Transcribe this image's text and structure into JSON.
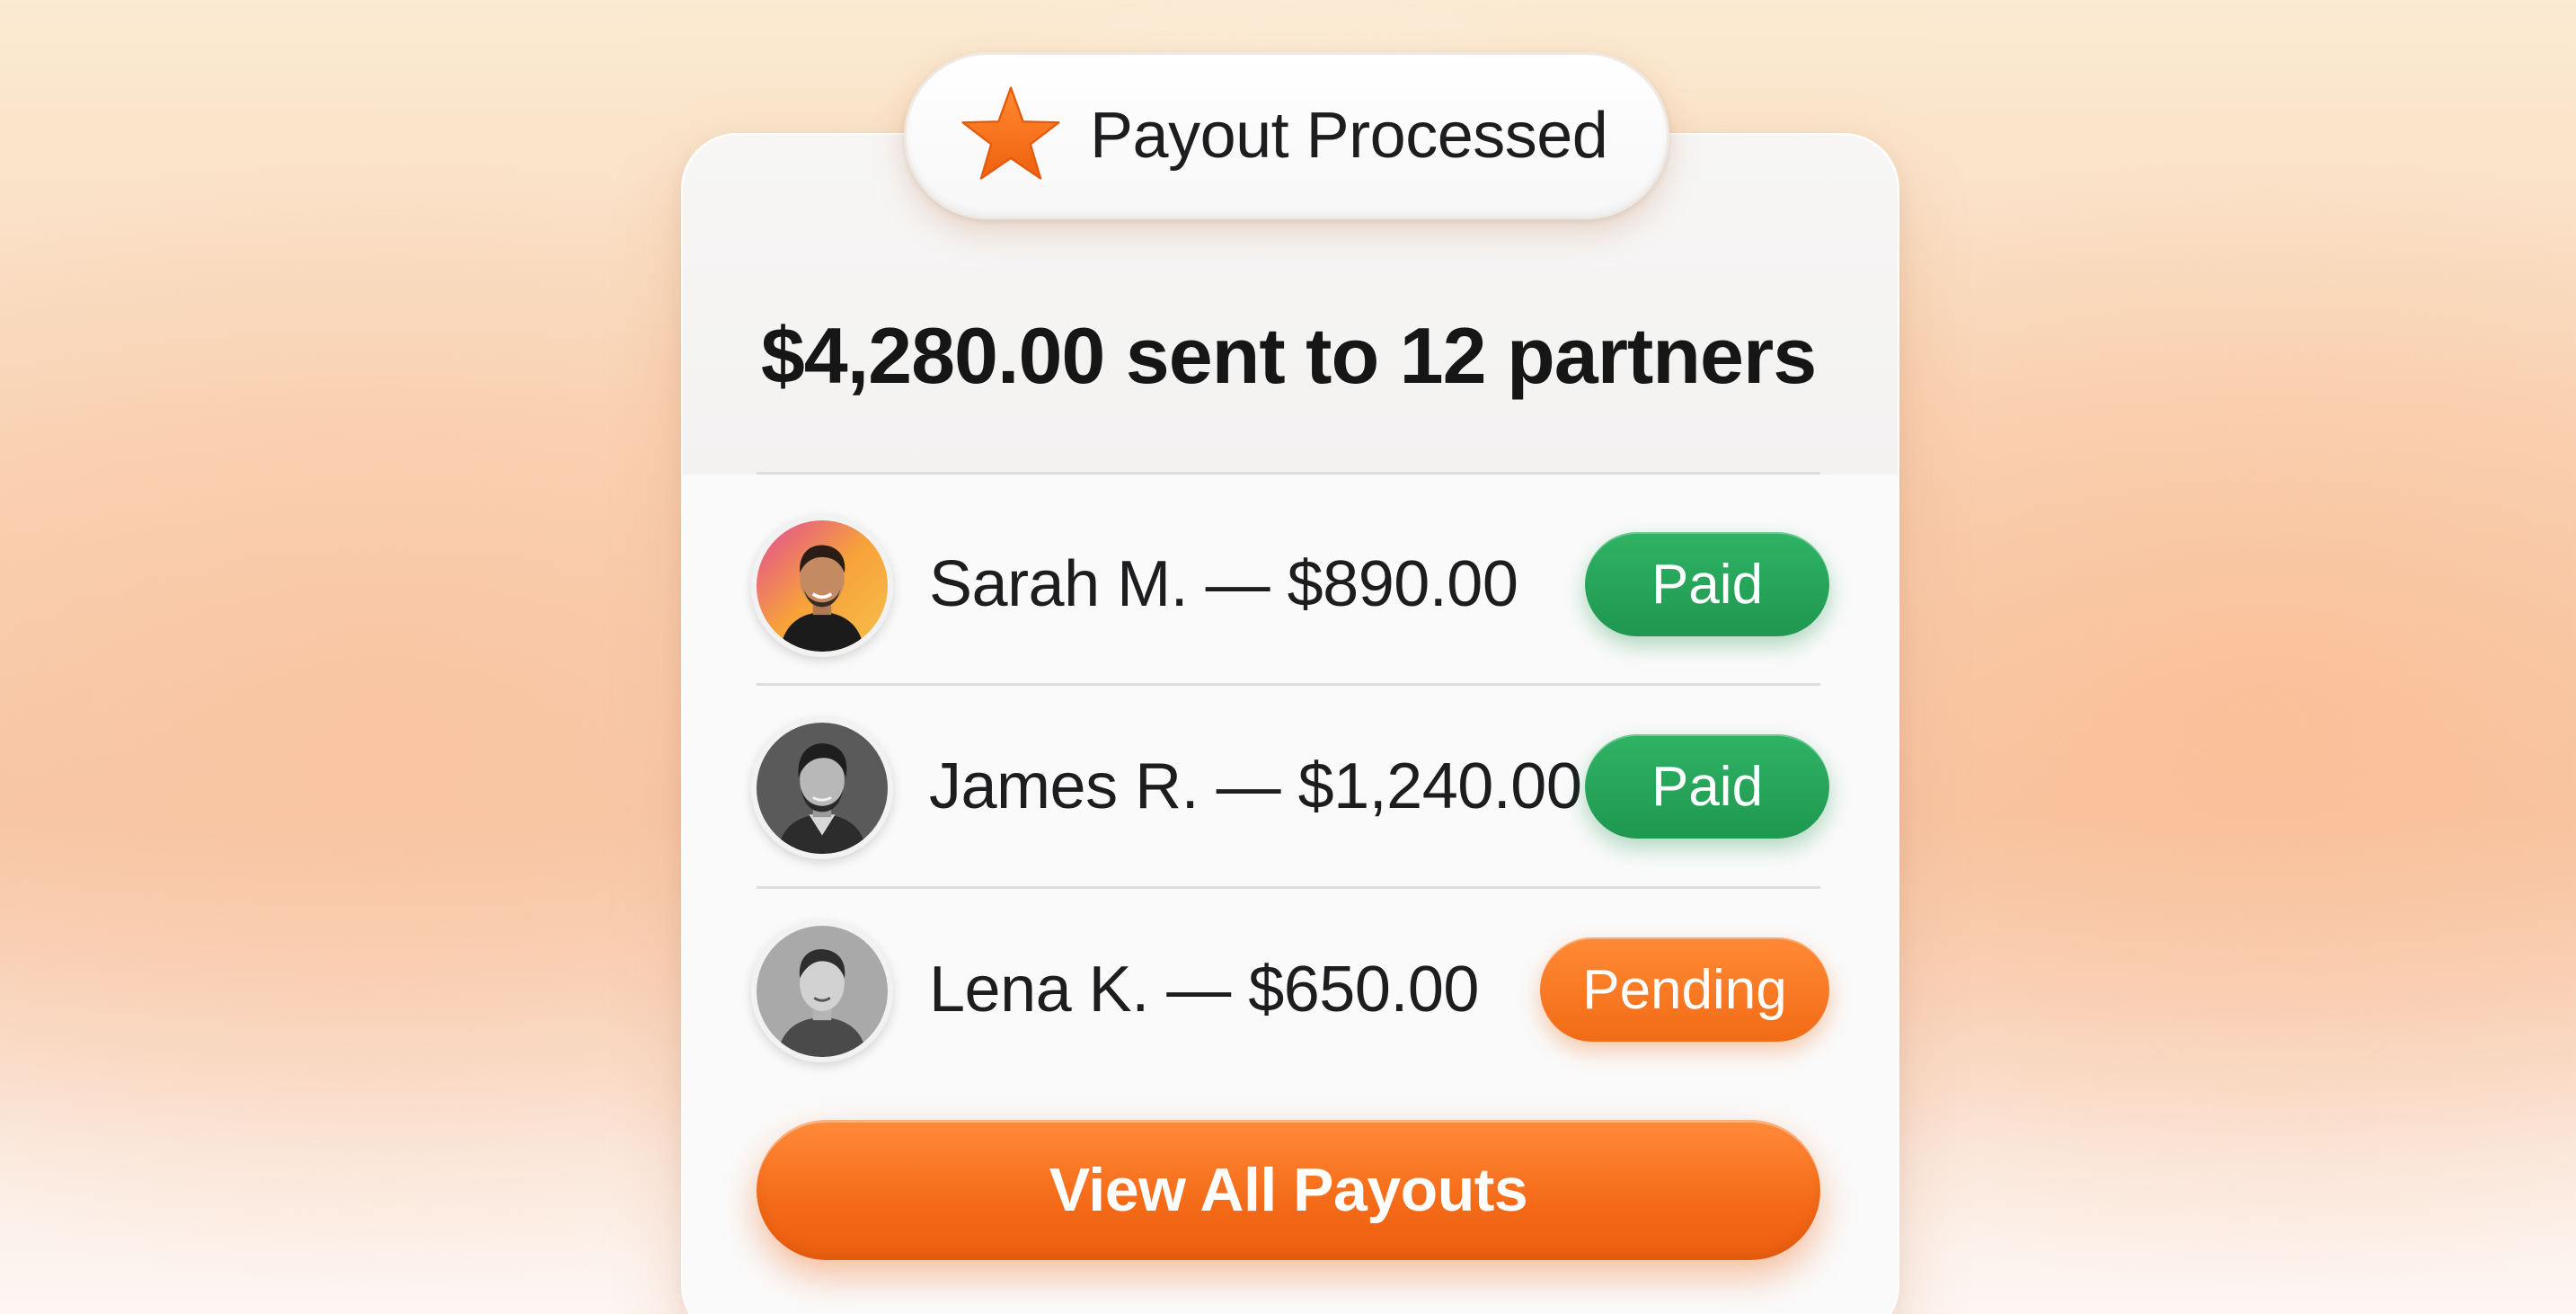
{
  "header": {
    "title": "Payout Processed",
    "icon": "star-icon",
    "accent": "#f26b15"
  },
  "summary": "$4,280.00 sent to 12 partners",
  "payouts": [
    {
      "name": "Sarah M.",
      "amount": "$890.00",
      "label": "Sarah M. — $890.00",
      "status": "Paid",
      "status_color": "#22a055"
    },
    {
      "name": "James R.",
      "amount": "$1,240.00",
      "label": "James R. — $1,240.00",
      "status": "Paid",
      "status_color": "#22a055"
    },
    {
      "name": "Lena K.",
      "amount": "$650.00",
      "label": "Lena K. — $650.00",
      "status": "Pending",
      "status_color": "#f26b15"
    }
  ],
  "actions": {
    "view_all_label": "View All Payouts"
  }
}
